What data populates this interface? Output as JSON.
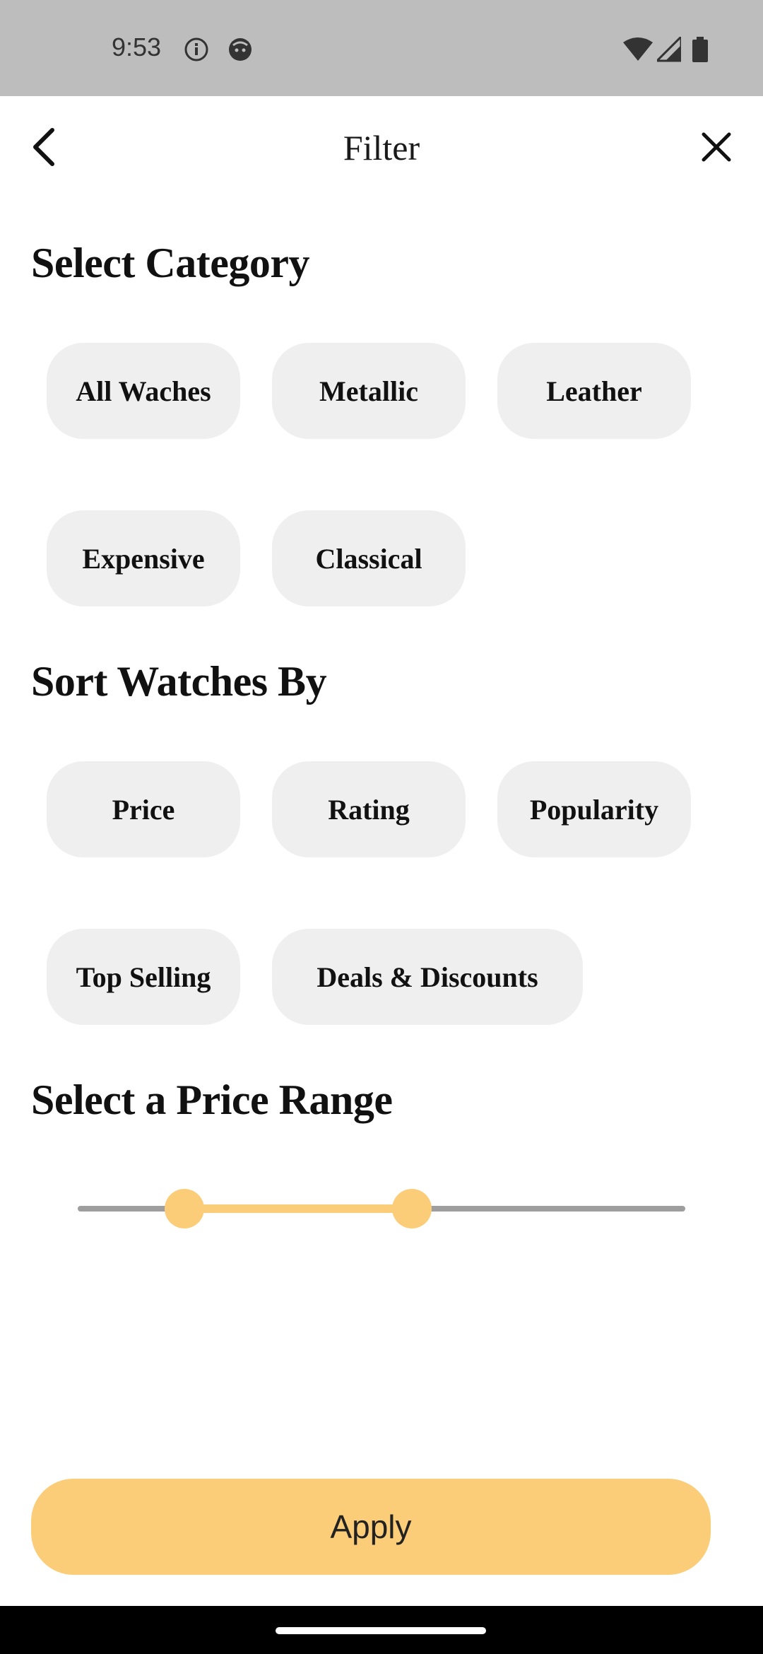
{
  "status_bar": {
    "time": "9:53",
    "icons": [
      "info-icon",
      "notification-icon",
      "wifi-icon",
      "signal-icon",
      "battery-icon"
    ]
  },
  "header": {
    "title": "Filter",
    "back_icon": "chevron-left-icon",
    "close_icon": "close-icon"
  },
  "category": {
    "heading": "Select Category",
    "chips": [
      "All Waches",
      "Metallic",
      "Leather",
      "Expensive",
      "Classical"
    ]
  },
  "sort": {
    "heading": "Sort Watches By",
    "chips": [
      "Price",
      "Rating",
      "Popularity",
      "Top Selling",
      "Deals & Discounts"
    ]
  },
  "price_range": {
    "heading": "Select a Price Range",
    "low_fraction": 0.175,
    "high_fraction": 0.55
  },
  "footer": {
    "apply_label": "Apply"
  },
  "colors": {
    "accent": "#fbcd78",
    "chip_background": "#efefef",
    "status_bar": "#bdbdbd"
  }
}
